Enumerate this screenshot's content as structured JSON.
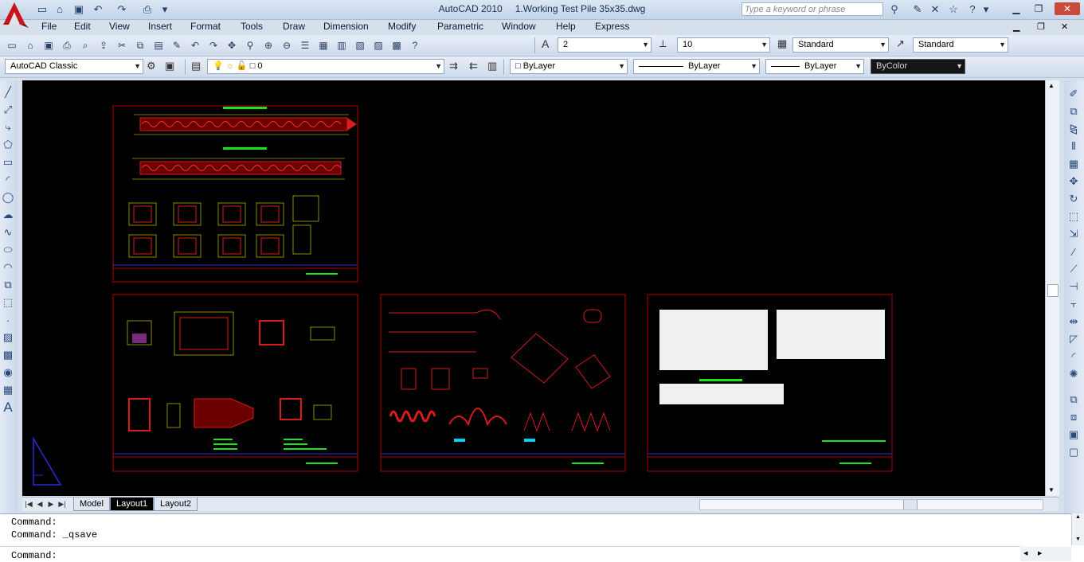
{
  "titlebar": {
    "app": "AutoCAD 2010",
    "document": "1.Working Test Pile 35x35.dwg",
    "search_placeholder": "Type a keyword or phrase"
  },
  "menu": [
    "File",
    "Edit",
    "View",
    "Insert",
    "Format",
    "Tools",
    "Draw",
    "Dimension",
    "Modify",
    "Parametric",
    "Window",
    "Help",
    "Express"
  ],
  "toolbar1": {
    "text_height": "2",
    "dim_scale": "10",
    "text_style": "Standard",
    "dim_style": "Standard"
  },
  "toolbar2": {
    "workspace": "AutoCAD Classic",
    "layer": "0",
    "color": "ByLayer",
    "linetype": "ByLayer",
    "lineweight": "ByLayer",
    "plotstyle": "ByColor"
  },
  "tabs": {
    "model": "Model",
    "layout1": "Layout1",
    "layout2": "Layout2"
  },
  "command": {
    "line1": "Command:",
    "line2": "Command:  _qsave",
    "prompt": "Command:"
  },
  "colors": {
    "canvas": "#000000",
    "sheet_border": "#b00000",
    "rebar": "#d81b1b",
    "dim": "#e6e600",
    "highlight": "#19e619",
    "cyan": "#00d0ff"
  },
  "icons": {
    "app": "autocad-logo-icon",
    "ucs": "ucs-icon"
  }
}
